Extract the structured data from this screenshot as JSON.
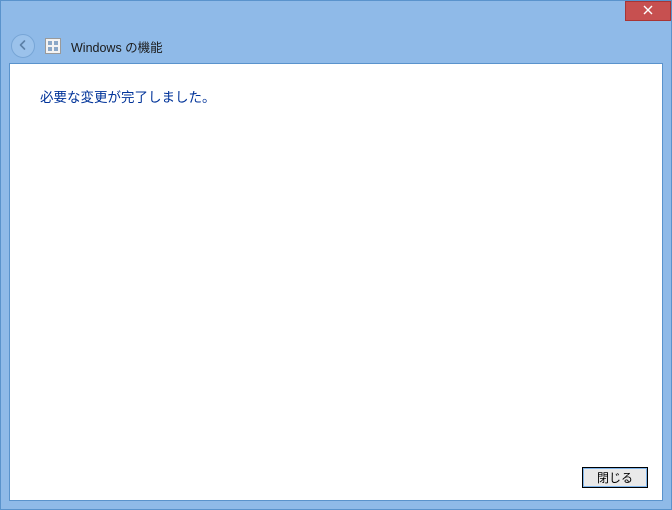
{
  "header": {
    "title": "Windows の機能"
  },
  "main": {
    "heading": "必要な変更が完了しました。"
  },
  "footer": {
    "close_label": "閉じる"
  }
}
